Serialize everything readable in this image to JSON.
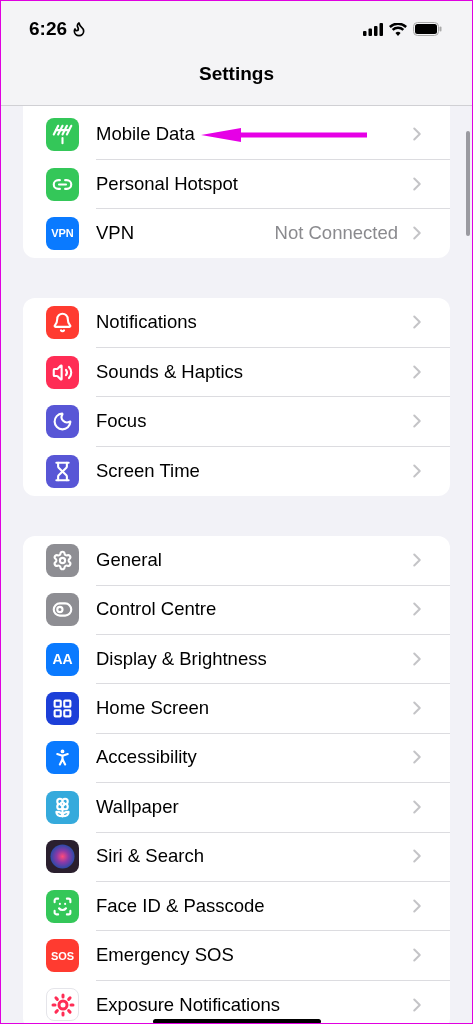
{
  "status_bar": {
    "time": "6:26"
  },
  "header": {
    "title": "Settings"
  },
  "groups": [
    {
      "items": [
        {
          "label": "Mobile Data",
          "color": "#34c759"
        },
        {
          "label": "Personal Hotspot",
          "color": "#34c759"
        },
        {
          "label": "VPN",
          "color": "#0a7aff",
          "icon_text": "VPN",
          "value": "Not Connected"
        }
      ]
    },
    {
      "items": [
        {
          "label": "Notifications",
          "color": "#ff3b30"
        },
        {
          "label": "Sounds & Haptics",
          "color": "#ff2d55"
        },
        {
          "label": "Focus",
          "color": "#5856d6"
        },
        {
          "label": "Screen Time",
          "color": "#5856d6"
        }
      ]
    },
    {
      "items": [
        {
          "label": "General",
          "color": "#8e8e93"
        },
        {
          "label": "Control Centre",
          "color": "#8e8e93"
        },
        {
          "label": "Display & Brightness",
          "color": "#0a7aff",
          "icon_text": "AA"
        },
        {
          "label": "Home Screen",
          "color": "#1c3fd8"
        },
        {
          "label": "Accessibility",
          "color": "#0a7aff"
        },
        {
          "label": "Wallpaper",
          "color": "#35aadc"
        },
        {
          "label": "Siri & Search",
          "color": "#2a1f2e"
        },
        {
          "label": "Face ID & Passcode",
          "color": "#34c759"
        },
        {
          "label": "Emergency SOS",
          "color": "#ff3b30",
          "icon_text": "SOS"
        },
        {
          "label": "Exposure Notifications",
          "color": "#ffffff"
        }
      ]
    }
  ]
}
